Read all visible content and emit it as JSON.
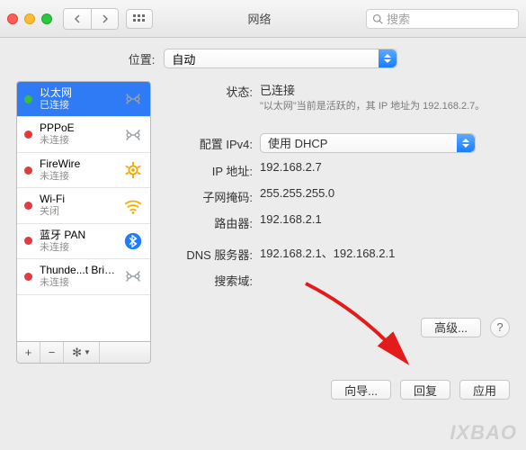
{
  "titlebar": {
    "title": "网络",
    "search_placeholder": "搜索"
  },
  "location": {
    "label": "位置:",
    "value": "自动"
  },
  "sidebar": {
    "items": [
      {
        "name": "以太网",
        "status": "已连接",
        "dot": "sd-green",
        "icon": "ethernet",
        "selected": true
      },
      {
        "name": "PPPoE",
        "status": "未连接",
        "dot": "sd-red",
        "icon": "ethernet"
      },
      {
        "name": "FireWire",
        "status": "未连接",
        "dot": "sd-red",
        "icon": "firewire"
      },
      {
        "name": "Wi-Fi",
        "status": "关闭",
        "dot": "sd-red",
        "icon": "wifi"
      },
      {
        "name": "蓝牙 PAN",
        "status": "未连接",
        "dot": "sd-red",
        "icon": "bluetooth"
      },
      {
        "name": "Thunde...t Bridge",
        "status": "未连接",
        "dot": "sd-red",
        "icon": "ethernet"
      }
    ],
    "buttons": {
      "add": "+",
      "remove": "−",
      "gear": "✻▾"
    }
  },
  "detail": {
    "status_label": "状态:",
    "status_value": "已连接",
    "status_sub": "\"以太网\"当前是活跃的，其 IP 地址为 192.168.2.7。",
    "ipv4_label": "配置 IPv4:",
    "ipv4_value": "使用 DHCP",
    "ip_label": "IP 地址:",
    "ip_value": "192.168.2.7",
    "mask_label": "子网掩码:",
    "mask_value": "255.255.255.0",
    "router_label": "路由器:",
    "router_value": "192.168.2.1",
    "dns_label": "DNS 服务器:",
    "dns_value": "192.168.2.1、192.168.2.1",
    "search_label": "搜索域:",
    "advanced": "高级...",
    "help": "?"
  },
  "bottom": {
    "wizard": "向导...",
    "revert": "回复",
    "apply": "应用"
  },
  "watermark": "IXBAO"
}
